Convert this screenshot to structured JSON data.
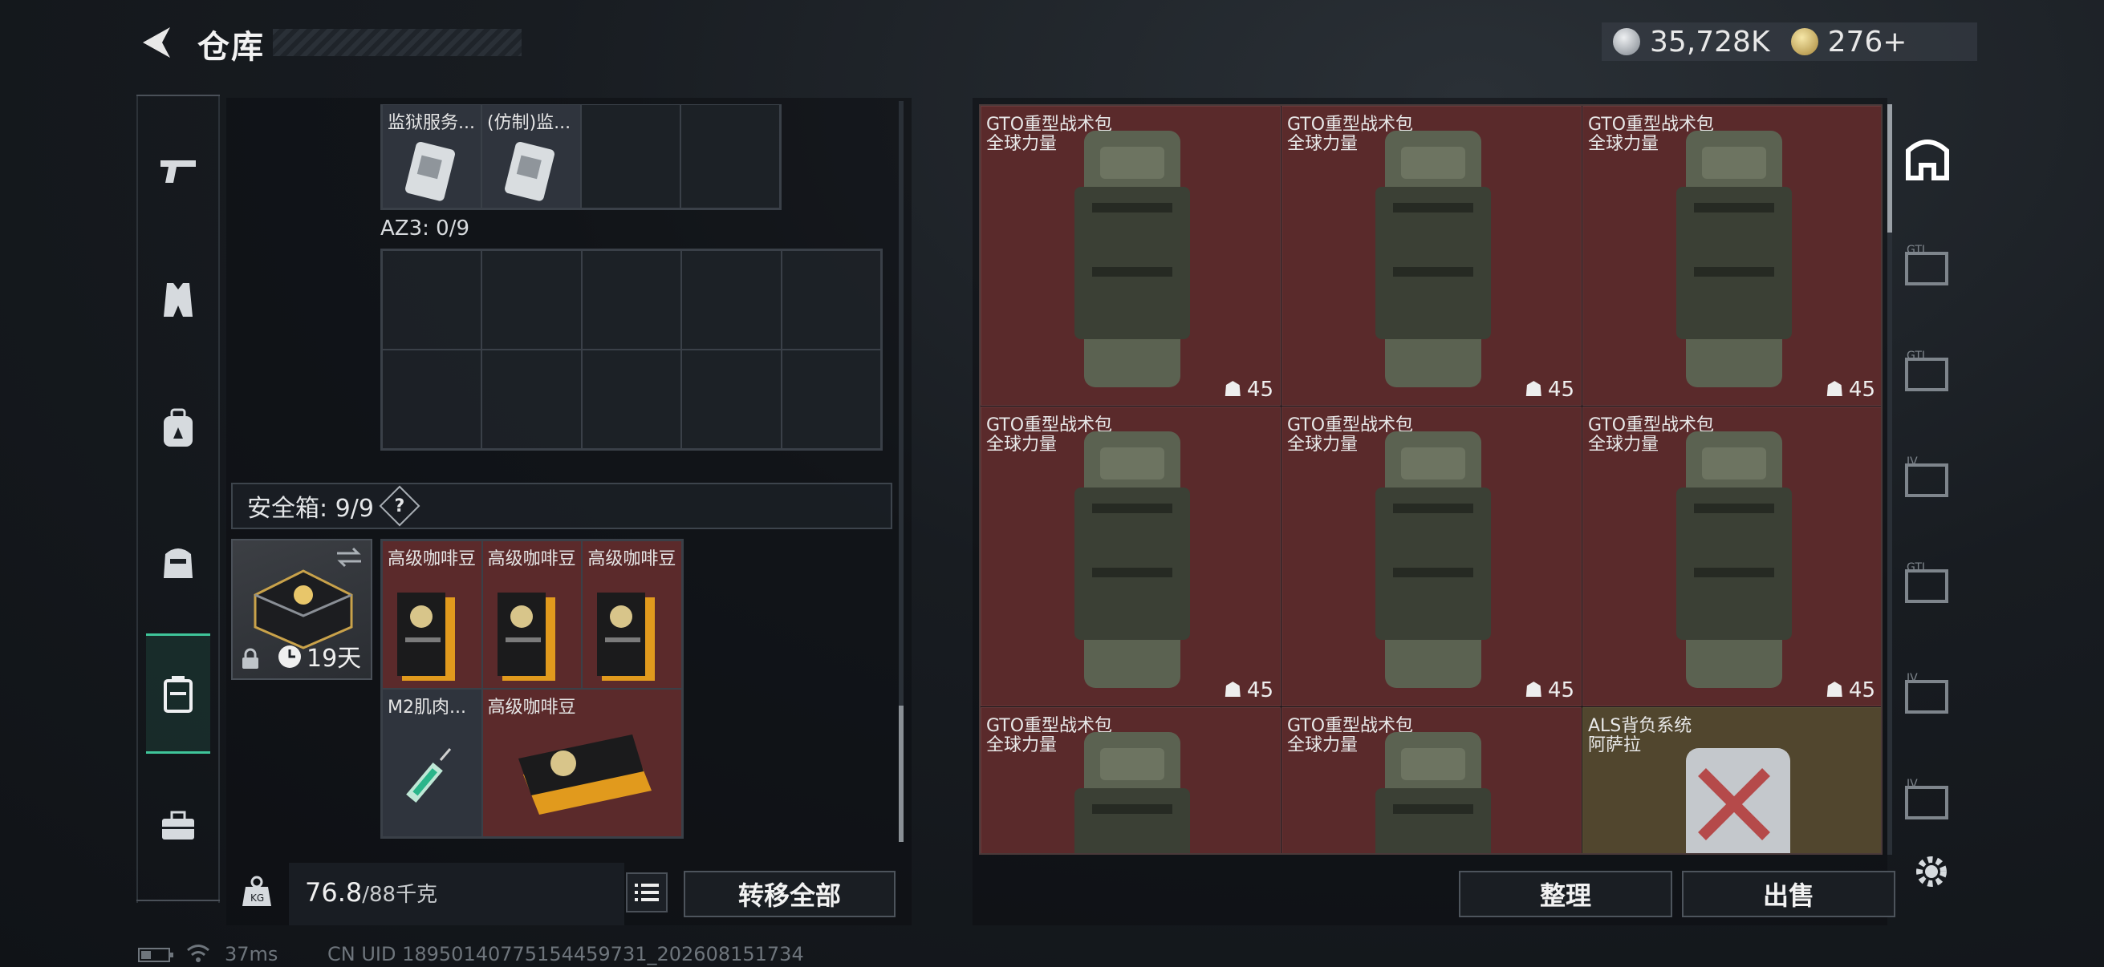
{
  "header": {
    "title": "仓库",
    "currency_silver": "35,728K",
    "currency_gold": "276+"
  },
  "rail": {
    "items": [
      "pistol-icon",
      "vest-icon",
      "backpack-icon",
      "armor-icon",
      "safe-box-icon",
      "toolbox-icon"
    ]
  },
  "left": {
    "top_items": [
      {
        "name": "监狱服务..."
      },
      {
        "name": "(仿制)监..."
      }
    ],
    "az3_label": "AZ3: 0/9",
    "safe_box_label": "安全箱: 9/9",
    "safe_box_help": "?",
    "safe_box_timer": "19天",
    "safe_items": [
      {
        "name": "高级咖啡豆"
      },
      {
        "name": "高级咖啡豆"
      },
      {
        "name": "高级咖啡豆"
      },
      {
        "name": "M2肌肉..."
      },
      {
        "name": "高级咖啡豆"
      }
    ],
    "weight_current": "76.8",
    "weight_max": "/88千克",
    "transfer_all": "转移全部"
  },
  "right": {
    "items": [
      {
        "line1": "GTO重型战术包",
        "line2": "全球力量",
        "count": "45"
      },
      {
        "line1": "GTO重型战术包",
        "line2": "全球力量",
        "count": "45"
      },
      {
        "line1": "GTO重型战术包",
        "line2": "全球力量",
        "count": "45"
      },
      {
        "line1": "GTO重型战术包",
        "line2": "全球力量",
        "count": "45"
      },
      {
        "line1": "GTO重型战术包",
        "line2": "全球力量",
        "count": "45"
      },
      {
        "line1": "GTO重型战术包",
        "line2": "全球力量",
        "count": "45"
      },
      {
        "line1": "GTO重型战术包",
        "line2": "全球力量",
        "count": ""
      },
      {
        "line1": "GTO重型战术包",
        "line2": "全球力量",
        "count": ""
      },
      {
        "line1": "ALS背负系统",
        "line2": "阿萨拉",
        "count": ""
      }
    ],
    "sort_button": "整理",
    "sell_button": "出售",
    "side_tabs": [
      "GTI",
      "GTI",
      "IV",
      "GTI",
      "IV",
      "IV"
    ]
  },
  "status": {
    "ping": "37ms",
    "uid": "CN UID 18950140775154459731_202608151734"
  },
  "colors": {
    "accent": "#3fc59a",
    "slot_red": "#5a2a2b",
    "slot_olive": "#51462e"
  }
}
